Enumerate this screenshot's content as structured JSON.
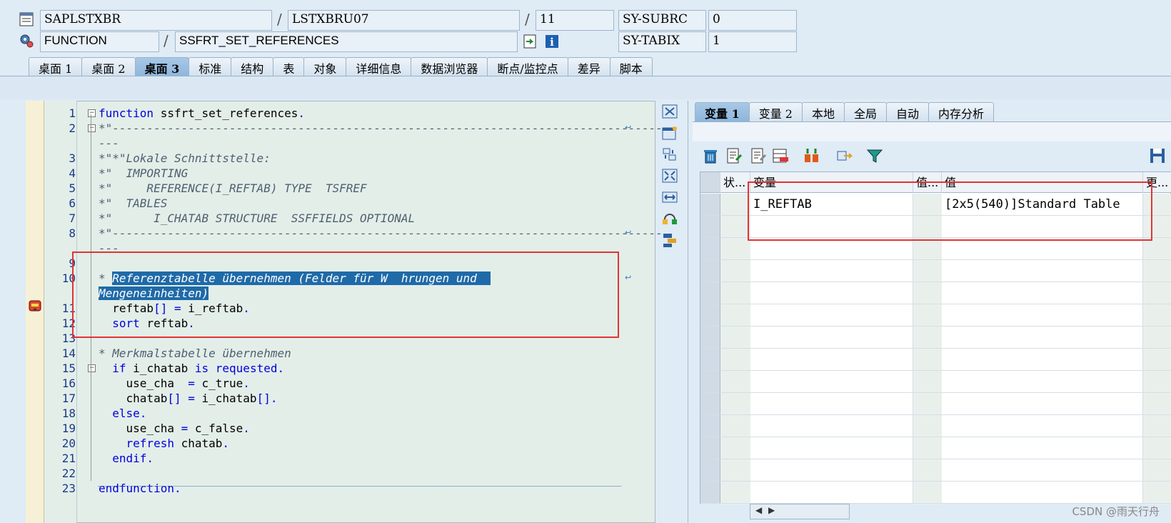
{
  "header": {
    "program": "SAPLSTXBR",
    "include": "LSTXBRU07",
    "line": "11",
    "event_type": "FUNCTION",
    "event_name": "SSFRT_SET_REFERENCES",
    "sysvar1_name": "SY-SUBRC",
    "sysvar1_value": "0",
    "sysvar2_name": "SY-TABIX",
    "sysvar2_value": "1"
  },
  "tabs": [
    {
      "label": "桌面 1",
      "active": false
    },
    {
      "label": "桌面 2",
      "active": false
    },
    {
      "label": "桌面 3",
      "active": true
    },
    {
      "label": "标准",
      "active": false
    },
    {
      "label": "结构",
      "active": false
    },
    {
      "label": "表",
      "active": false
    },
    {
      "label": "对象",
      "active": false
    },
    {
      "label": "详细信息",
      "active": false
    },
    {
      "label": "数据浏览器",
      "active": false
    },
    {
      "label": "断点/监控点",
      "active": false
    },
    {
      "label": "差异",
      "active": false
    },
    {
      "label": "脚本",
      "active": false
    }
  ],
  "code": {
    "lines": [
      {
        "n": "1",
        "segs": [
          [
            "kw",
            "function"
          ],
          [
            "id",
            " ssfrt_set_references"
          ],
          [
            "kw",
            "."
          ]
        ]
      },
      {
        "n": "2",
        "segs": [
          [
            "cm",
            "*\"--------------------------------------------------------------------------------"
          ]
        ]
      },
      {
        "n": "",
        "segs": [
          [
            "cm",
            "---"
          ]
        ]
      },
      {
        "n": "3",
        "segs": [
          [
            "cm",
            "*\"*\"Lokale Schnittstelle:"
          ]
        ]
      },
      {
        "n": "4",
        "segs": [
          [
            "cm",
            "*\"  IMPORTING"
          ]
        ]
      },
      {
        "n": "5",
        "segs": [
          [
            "cm",
            "*\"     REFERENCE(I_REFTAB) TYPE  TSFREF"
          ]
        ]
      },
      {
        "n": "6",
        "segs": [
          [
            "cm",
            "*\"  TABLES"
          ]
        ]
      },
      {
        "n": "7",
        "segs": [
          [
            "cm",
            "*\"      I_CHATAB STRUCTURE  SSFFIELDS OPTIONAL"
          ]
        ]
      },
      {
        "n": "8",
        "segs": [
          [
            "cm",
            "*\"--------------------------------------------------------------------------------"
          ]
        ]
      },
      {
        "n": "",
        "segs": [
          [
            "cm",
            "---"
          ]
        ]
      },
      {
        "n": "9",
        "segs": [
          [
            "id",
            ""
          ]
        ]
      },
      {
        "n": "10",
        "segs": [
          [
            "cm",
            "* "
          ],
          [
            "hl",
            "Referenztabelle übernehmen (Felder für W  hrungen und  "
          ]
        ]
      },
      {
        "n": "",
        "segs": [
          [
            "hl",
            "Mengeneinheiten)"
          ]
        ]
      },
      {
        "n": "11",
        "segs": [
          [
            "id",
            "  reftab"
          ],
          [
            "kw",
            "[] = "
          ],
          [
            "id",
            "i_reftab"
          ],
          [
            "kw",
            "."
          ]
        ]
      },
      {
        "n": "12",
        "segs": [
          [
            "kw",
            "  sort "
          ],
          [
            "id",
            "reftab"
          ],
          [
            "kw",
            "."
          ]
        ]
      },
      {
        "n": "13",
        "segs": [
          [
            "id",
            ""
          ]
        ]
      },
      {
        "n": "14",
        "segs": [
          [
            "cm",
            "* Merkmalstabelle übernehmen"
          ]
        ]
      },
      {
        "n": "15",
        "segs": [
          [
            "kw",
            "  if "
          ],
          [
            "id",
            "i_chatab "
          ],
          [
            "kw",
            "is requested."
          ]
        ]
      },
      {
        "n": "16",
        "segs": [
          [
            "id",
            "    use_cha  "
          ],
          [
            "kw",
            "= "
          ],
          [
            "id",
            "c_true"
          ],
          [
            "kw",
            "."
          ]
        ]
      },
      {
        "n": "17",
        "segs": [
          [
            "id",
            "    chatab"
          ],
          [
            "kw",
            "[] = "
          ],
          [
            "id",
            "i_chatab"
          ],
          [
            "kw",
            "[]."
          ]
        ]
      },
      {
        "n": "18",
        "segs": [
          [
            "kw",
            "  else."
          ]
        ]
      },
      {
        "n": "19",
        "segs": [
          [
            "id",
            "    use_cha "
          ],
          [
            "kw",
            "= "
          ],
          [
            "id",
            "c_false"
          ],
          [
            "kw",
            "."
          ]
        ]
      },
      {
        "n": "20",
        "segs": [
          [
            "kw",
            "    refresh "
          ],
          [
            "id",
            "chatab"
          ],
          [
            "kw",
            "."
          ]
        ]
      },
      {
        "n": "21",
        "segs": [
          [
            "kw",
            "  endif."
          ]
        ]
      },
      {
        "n": "22",
        "segs": [
          [
            "id",
            ""
          ]
        ]
      },
      {
        "n": "23",
        "segs": [
          [
            "kw",
            "endfunction."
          ]
        ]
      }
    ]
  },
  "right_tabs": [
    {
      "label": "变量 1",
      "active": true
    },
    {
      "label": "变量 2",
      "active": false
    },
    {
      "label": "本地",
      "active": false
    },
    {
      "label": "全局",
      "active": false
    },
    {
      "label": "自动",
      "active": false
    },
    {
      "label": "内存分析",
      "active": false
    }
  ],
  "vars_table": {
    "headers": {
      "status": "状...",
      "variable": "变量",
      "value_short": "值...",
      "value": "值",
      "changed": "更..."
    },
    "rows": [
      {
        "variable": "I_REFTAB",
        "value": "[2x5(540)]Standard Table"
      }
    ]
  },
  "icons": {
    "program": "program-icon",
    "event": "event-gear-icon",
    "breakpoint": "breakpoint-icon"
  },
  "colors": {
    "keyword": "#0000dd",
    "comment": "#4f5f6f",
    "highlight": "#1f6aa8",
    "annotation": "#e23434"
  },
  "watermark": "CSDN @雨天行舟"
}
